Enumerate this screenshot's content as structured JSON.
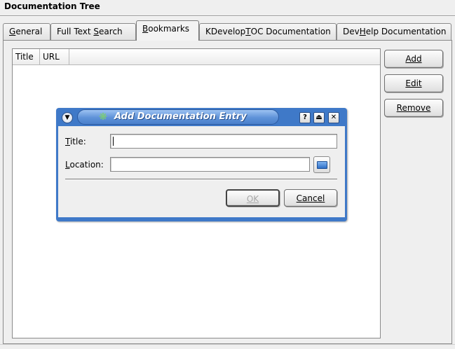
{
  "header": {
    "title": "Documentation Tree"
  },
  "tabs": [
    {
      "label": "General",
      "mnemonic_index": 0,
      "active": false
    },
    {
      "label": "Full Text Search",
      "mnemonic_index": 10,
      "active": false
    },
    {
      "label": "Bookmarks",
      "mnemonic_index": 0,
      "active": true
    },
    {
      "label": "KDevelopTOC Documentation",
      "mnemonic_index": 8,
      "active": false
    },
    {
      "label": "DevHelp Documentation",
      "mnemonic_index": 3,
      "active": false
    }
  ],
  "bookmarks_list": {
    "columns": [
      "Title",
      "URL"
    ],
    "rows": []
  },
  "side_buttons": {
    "add": "Add",
    "edit": "Edit",
    "remove": "Remove"
  },
  "dialog": {
    "title": "Add Documentation Entry",
    "title_field": {
      "label": "Title:",
      "value": ""
    },
    "location_field": {
      "label": "Location:",
      "value": ""
    },
    "ok_label": "OK",
    "cancel_label": "Cancel",
    "ok_enabled": false
  },
  "colors": {
    "titlebar_blue": "#3f79c8",
    "window_bg": "#efefef"
  },
  "icons": {
    "dialog_menu": "chevron-down-icon",
    "dialog_app": "gear-icon",
    "help": "help-icon",
    "shade": "eject-icon",
    "close": "close-icon",
    "browse": "folder-open-icon"
  }
}
